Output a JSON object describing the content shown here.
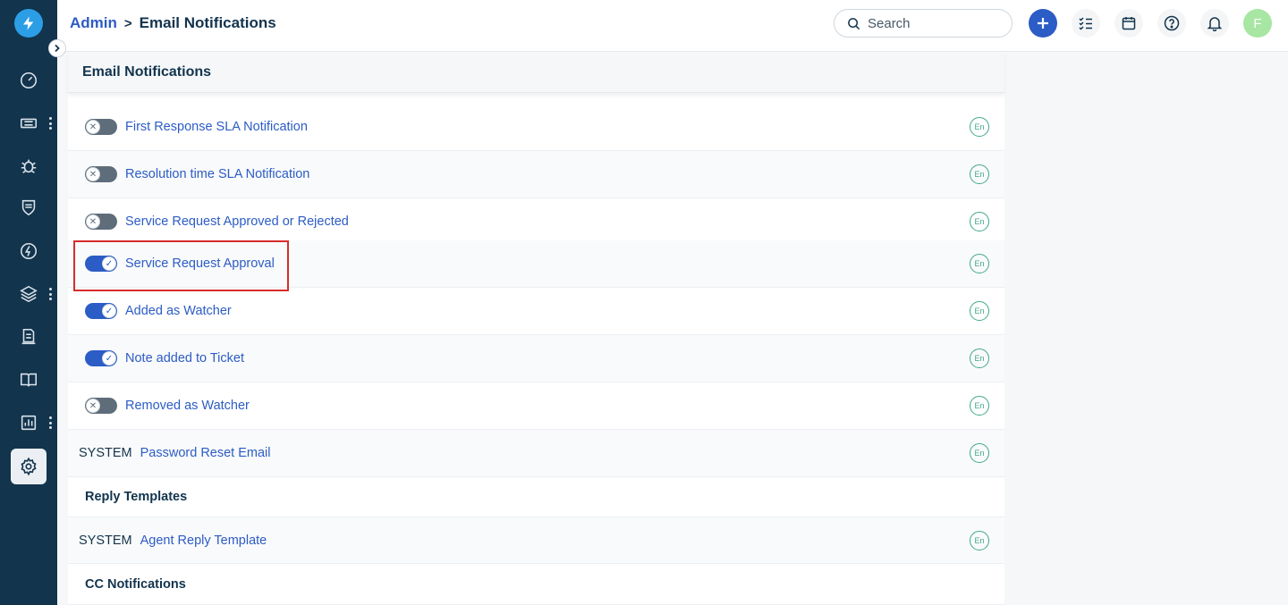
{
  "breadcrumb": {
    "parent": "Admin",
    "separator": ">",
    "current": "Email Notifications"
  },
  "search": {
    "placeholder": "Search"
  },
  "avatar": {
    "initial": "F"
  },
  "panel": {
    "title": "Email Notifications"
  },
  "notifications": [
    {
      "label": "First Response SLA Notification",
      "enabled": false,
      "lang": "En"
    },
    {
      "label": "Resolution time SLA Notification",
      "enabled": false,
      "lang": "En"
    },
    {
      "label": "Service Request Approved or Rejected",
      "enabled": false,
      "lang": "En"
    },
    {
      "label": "Service Request Approval",
      "enabled": true,
      "lang": "En"
    },
    {
      "label": "Added as Watcher",
      "enabled": true,
      "lang": "En"
    },
    {
      "label": "Note added to Ticket",
      "enabled": true,
      "lang": "En"
    },
    {
      "label": "Removed as Watcher",
      "enabled": false,
      "lang": "En"
    }
  ],
  "system_rows": [
    {
      "tag": "SYSTEM",
      "label": "Password Reset Email",
      "lang": "En"
    },
    {
      "tag": "SYSTEM",
      "label": "Agent Reply Template",
      "lang": "En"
    }
  ],
  "sections": {
    "reply_templates": "Reply Templates",
    "cc_notifications": "CC Notifications"
  },
  "colors": {
    "nav_bg": "#12344d",
    "accent": "#2c5cc5",
    "lang_badge": "#3fa78b",
    "highlight": "#d72c2c"
  },
  "icons": {
    "nav": [
      "dashboard-icon",
      "tickets-icon",
      "problems-icon",
      "changes-icon",
      "releases-icon",
      "assets-icon",
      "contracts-icon",
      "solutions-icon",
      "analytics-icon",
      "admin-gear-icon"
    ],
    "header": [
      "search-icon",
      "add-icon",
      "todo-icon",
      "calendar-icon",
      "help-icon",
      "bell-icon"
    ]
  }
}
